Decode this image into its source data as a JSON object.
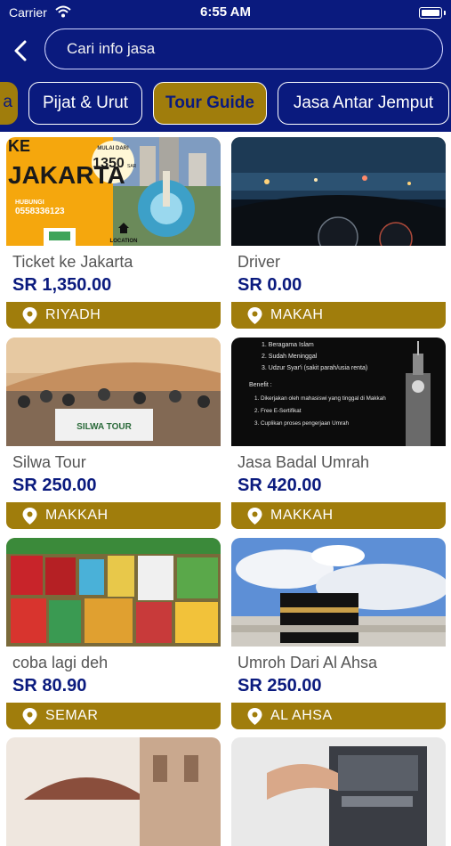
{
  "status_bar": {
    "carrier": "Carrier",
    "time": "6:55 AM"
  },
  "search": {
    "placeholder": "Cari info jasa"
  },
  "categories": [
    {
      "label": "a",
      "state": "partial"
    },
    {
      "label": "Pijat & Urut",
      "state": "normal"
    },
    {
      "label": "Tour Guide",
      "state": "selected"
    },
    {
      "label": "Jasa Antar Jemput",
      "state": "normal"
    }
  ],
  "listings": [
    {
      "title": "Ticket ke Jakarta",
      "price": "SR 1,350.00",
      "location": "RIYADH",
      "image": {
        "heading_line1": "KE",
        "heading_line2": "JAKARTA",
        "badge_top": "MULAI DARI",
        "badge_price": "1350",
        "badge_unit": "SAR",
        "contact_label": "HUBUNGI",
        "contact_phone": "0558336123",
        "location_label": "LOCATION"
      }
    },
    {
      "title": "Driver",
      "price": "SR 0.00",
      "location": "MAKAH"
    },
    {
      "title": "Silwa Tour",
      "price": "SR 250.00",
      "location": "MAKKAH",
      "image": {
        "banner": "SILWA TOUR"
      }
    },
    {
      "title": "Jasa Badal Umrah",
      "price": "SR 420.00",
      "location": "MAKKAH",
      "image": {
        "lines": [
          "1. Beragama Islam",
          "2. Sudah Meninggal",
          "3. Udzur Syar'i (sakit parah/usia renta)",
          "Benefit :",
          "1. Dikerjakan oleh mahasiswi yang tinggal di Makkah",
          "2. Free E-Sertifikat",
          "3. Cuplikan proses pengerjaan Umrah"
        ]
      }
    },
    {
      "title": "coba lagi deh",
      "price": "SR 80.90",
      "location": "SEMAR"
    },
    {
      "title": "Umroh Dari Al Ahsa",
      "price": "SR 250.00",
      "location": "AL AHSA"
    },
    {
      "title": "",
      "price": "",
      "location": ""
    },
    {
      "title": "",
      "price": "",
      "location": ""
    }
  ],
  "colors": {
    "primary": "#0a1a7e",
    "accent": "#a07d0c"
  },
  "icons": {
    "back": "chevron-left-icon",
    "location": "map-pin-icon",
    "wifi": "wifi-icon",
    "battery": "battery-icon"
  }
}
